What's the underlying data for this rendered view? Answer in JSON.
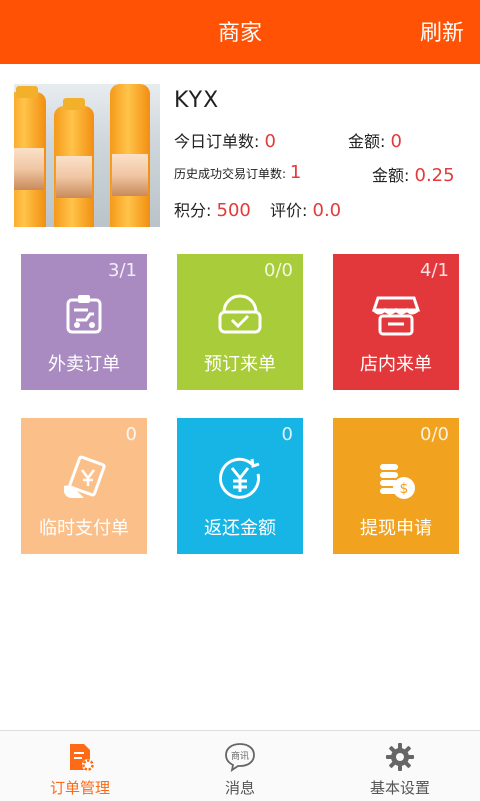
{
  "header": {
    "title": "商家",
    "refresh_label": "刷新",
    "color": "#ff5204"
  },
  "store": {
    "name": "KYX",
    "today_orders_label": "今日订单数:",
    "today_orders_value": "0",
    "today_amount_label": "金额:",
    "today_amount_value": "0",
    "history_label": "历史成功交易订单数:",
    "history_value": "1",
    "history_amount_label": "金额:",
    "history_amount_value": "0.25",
    "points_label": "积分:",
    "points_value": "500",
    "rating_label": "评价:",
    "rating_value": "0.0"
  },
  "tiles": [
    {
      "label": "外卖订单",
      "count": "3/1",
      "color": "#a98bc2",
      "icon": "delivery-icon"
    },
    {
      "label": "预订来单",
      "count": "0/0",
      "color": "#a9cc3a",
      "icon": "reservation-icon"
    },
    {
      "label": "店内来单",
      "count": "4/1",
      "color": "#e2383b",
      "icon": "store-icon"
    },
    {
      "label": "临时支付单",
      "count": "0",
      "color": "#fbc08a",
      "icon": "payment-slip-icon"
    },
    {
      "label": "返还金额",
      "count": "0",
      "color": "#17b5e6",
      "icon": "yuan-icon"
    },
    {
      "label": "提现申请",
      "count": "0/0",
      "color": "#f1a21f",
      "icon": "coins-icon"
    }
  ],
  "tabbar": {
    "items": [
      {
        "label": "订单管理",
        "icon": "order-manage-icon",
        "active": true
      },
      {
        "label": "消息",
        "icon": "message-icon",
        "icon_text": "商讯",
        "active": false
      },
      {
        "label": "基本设置",
        "icon": "gear-icon",
        "active": false
      }
    ],
    "active_color": "#ff6a16",
    "inactive_color": "#555555"
  }
}
